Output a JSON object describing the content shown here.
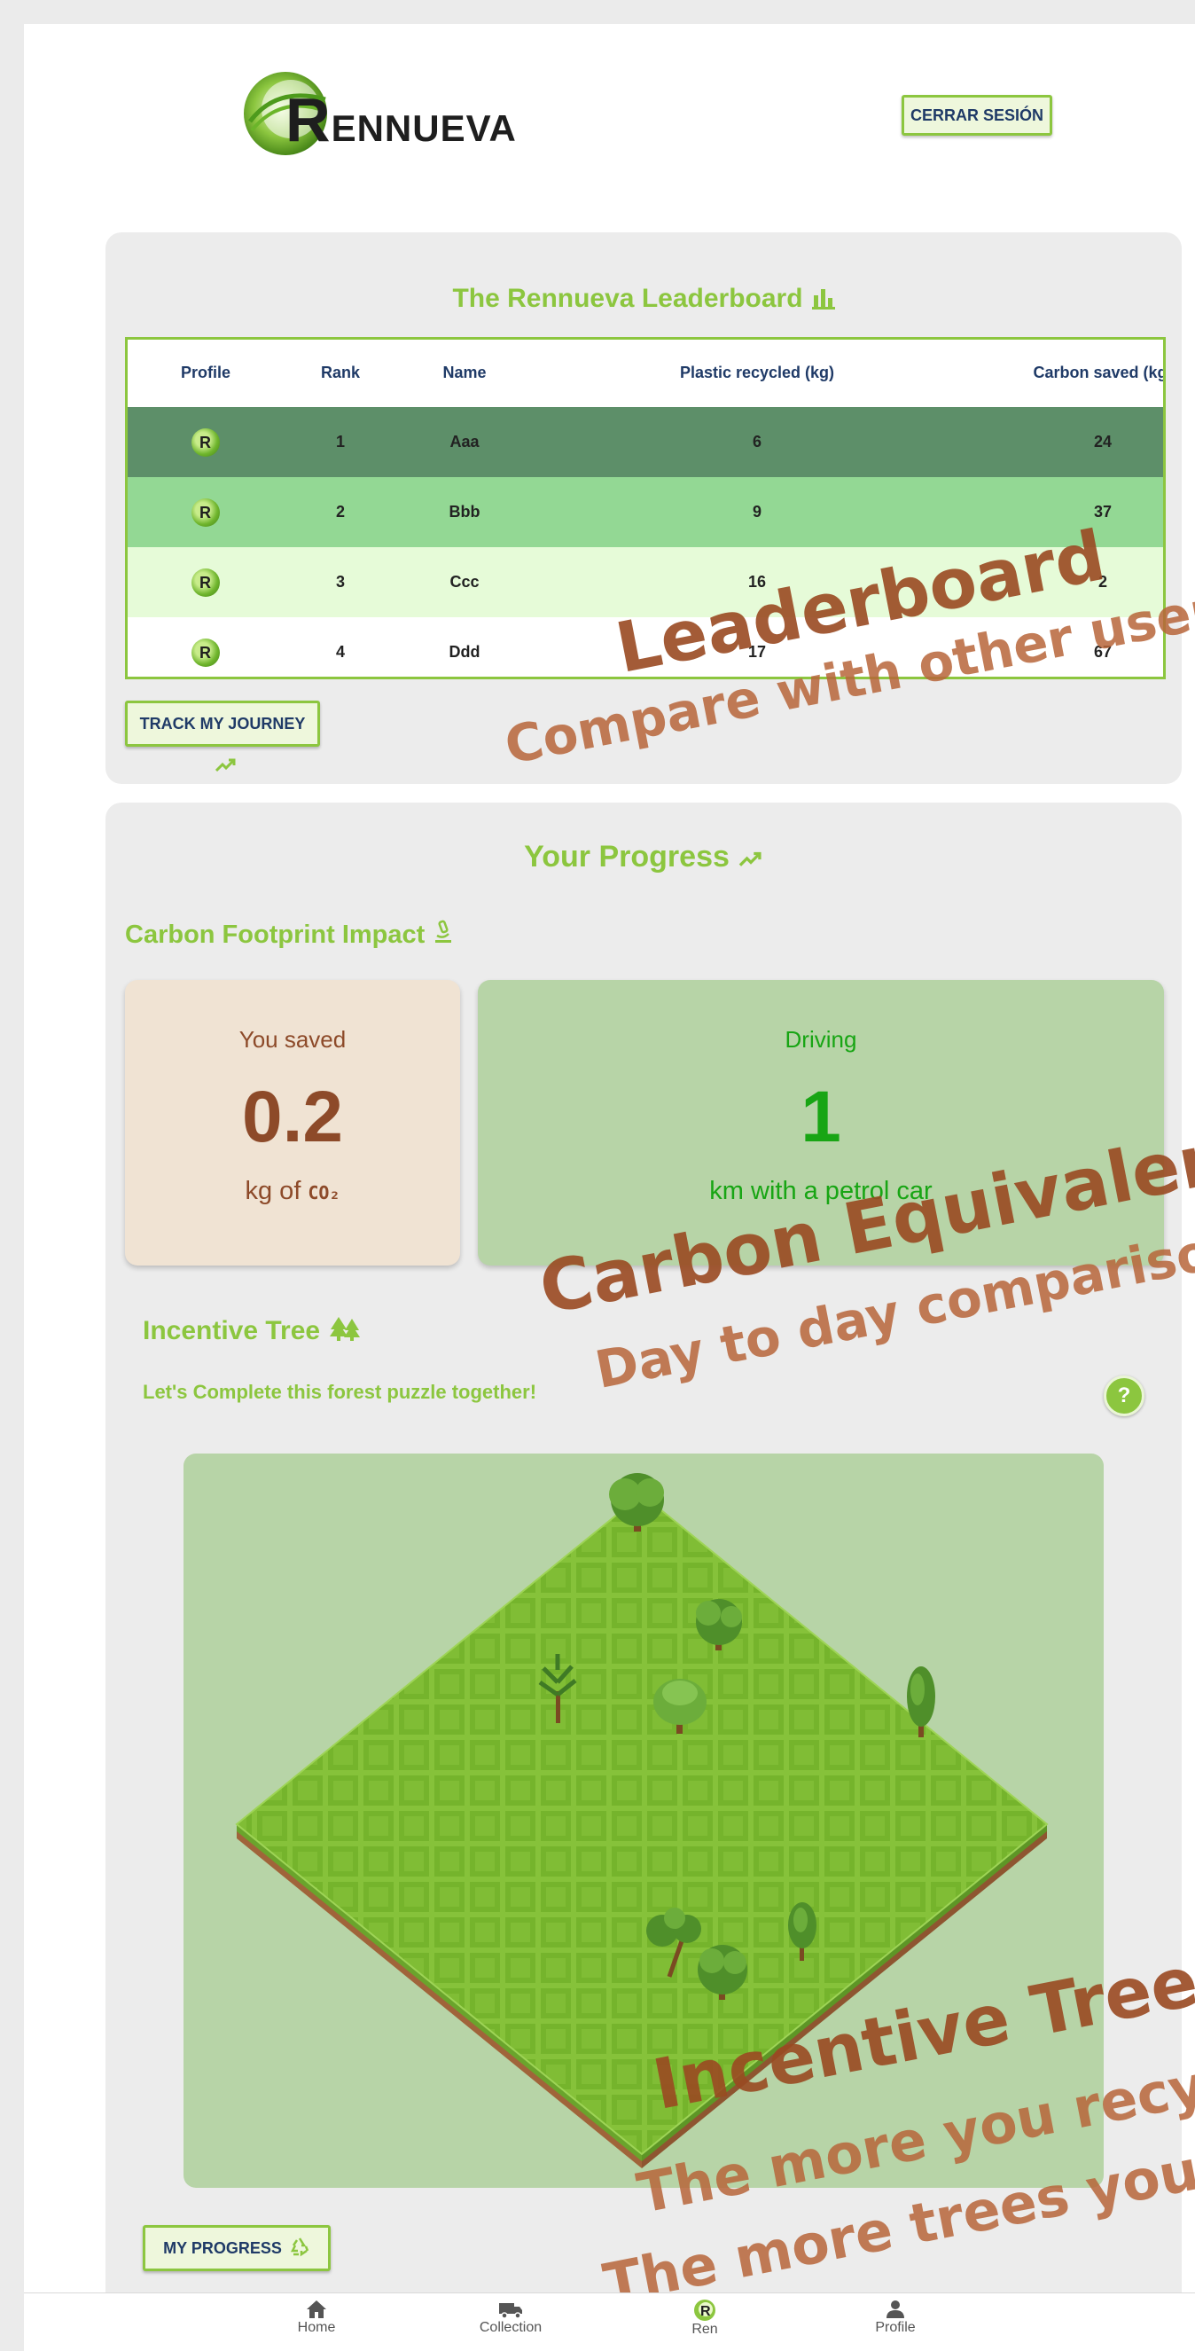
{
  "header": {
    "logo_text_first": "R",
    "logo_text_rest": "ENNUEVA",
    "logout_label": "CERRAR SESIÓN"
  },
  "leaderboard": {
    "title": "The Rennueva Leaderboard",
    "columns": [
      "Profile",
      "Rank",
      "Name",
      "Plastic recycled (kg)",
      "Carbon saved (kg)"
    ],
    "rows": [
      {
        "avatar": "R",
        "rank": "1",
        "name": "Aaa",
        "plastic": "6",
        "carbon": "24",
        "bg": "#5d8f69"
      },
      {
        "avatar": "R",
        "rank": "2",
        "name": "Bbb",
        "plastic": "9",
        "carbon": "37",
        "bg": "#93d894"
      },
      {
        "avatar": "R",
        "rank": "3",
        "name": "Ccc",
        "plastic": "16",
        "carbon": "2",
        "bg": "#e6fbd8"
      },
      {
        "avatar": "R",
        "rank": "4",
        "name": "Ddd",
        "plastic": "17",
        "carbon": "67",
        "bg": "#ffffff"
      }
    ],
    "track_button": "TRACK MY JOURNEY"
  },
  "progress": {
    "title": "Your Progress",
    "carbon_title": "Carbon Footprint Impact",
    "saved_card": {
      "label": "You saved",
      "value": "0.2",
      "unit_prefix": "kg of",
      "unit_symbol": "CO₂"
    },
    "driving_card": {
      "label": "Driving",
      "value": "1",
      "unit": "km with a petrol car"
    },
    "tree_title": "Incentive Tree",
    "tree_subtitle": "Let's Complete this forest puzzle together!",
    "help_label": "?",
    "my_progress_button": "MY PROGRESS"
  },
  "overlays": {
    "leaderboard_title": "Leaderboard",
    "leaderboard_sub": "Compare with other users",
    "carbon_title": "Carbon Equivalence",
    "carbon_sub": "Day to day comparison",
    "tree_title": "Incentive Tree!",
    "tree_sub1": "The more you recycle",
    "tree_sub2": "The more trees you plant"
  },
  "nav": {
    "items": [
      {
        "label": "Home",
        "icon": "home-icon"
      },
      {
        "label": "Collection",
        "icon": "truck-icon"
      },
      {
        "label": "Ren",
        "icon": "rennueva-logo-icon"
      },
      {
        "label": "Profile",
        "icon": "person-icon"
      }
    ]
  },
  "colors": {
    "accent": "#8cc63f",
    "text_navy": "#1f3a67",
    "saved_brown": "#8d4a29",
    "driving_green": "#18a514",
    "overlay_brown": "#9a4a22"
  }
}
